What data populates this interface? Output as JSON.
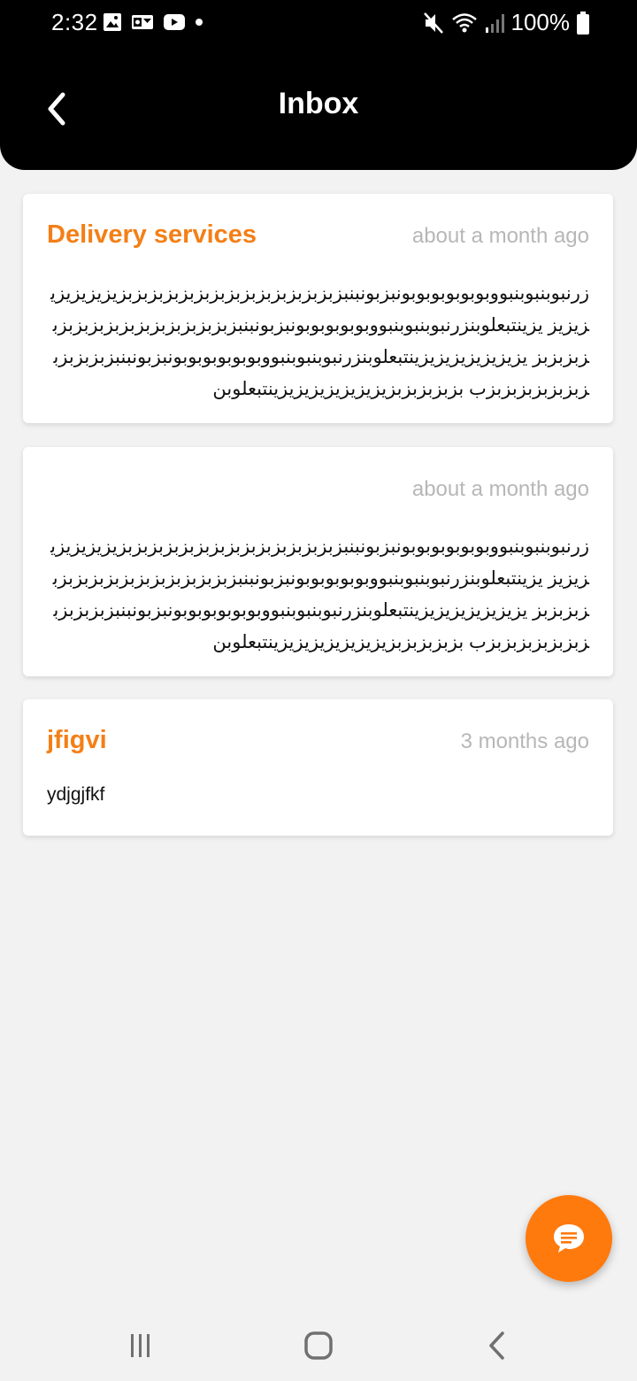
{
  "status_bar": {
    "time": "2:32",
    "battery": "100%",
    "icons_left": [
      "gallery-icon",
      "outlook-icon",
      "youtube-icon",
      "dot-icon"
    ],
    "icons_right": [
      "mute-icon",
      "wifi-icon",
      "signal-icon",
      "battery-icon"
    ]
  },
  "app_bar": {
    "title": "Inbox",
    "back_icon": "chevron-left-icon"
  },
  "messages": [
    {
      "title": "Delivery services",
      "time": "about a month ago",
      "body": "زرنبوبنبوبنبووبوبوبوبوبوبونبزبونبنبزبزبزبزبزبزبزبزبزبزبزبزبزبزبزيزيزيزيزيزيزيز يزينتبعلوبنزرنبوبنبوبنبووبوبوبوبوبونبزبونبنبزبزبزبزبزبزبزبزبزبزبزبزبزبزبزبز يزيزيزيزيزيزيزينتبعلوبنزرنبوبنبوبنبووبوبوبوبوبوبونبزبونبنبزبزبزبزبزبزبزبزبزبزبزب بزبزبزبزبزيزيزيزيزيزيزيزينتبعلوبن"
    },
    {
      "title": "",
      "time": "about a month ago",
      "body": "زرنبوبنبوبنبووبوبوبوبوبوبونبزبونبنبزبزبزبزبزبزبزبزبزبزبزبزبزبزبزيزيزيزيزيزيزيز يزينتبعلوبنزرنبوبنبوبنبووبوبوبوبوبونبزبونبنبزبزبزبزبزبزبزبزبزبزبزبزبزبزبزبز يزيزيزيزيزيزيزينتبعلوبنزرنبوبنبوبنبووبوبوبوبوبوبونبزبونبنبزبزبزبزبزبزبزبزبزبزبزب بزبزبزبزبزيزيزيزيزيزيزيزينتبعلوبن"
    },
    {
      "title": "jfigvi",
      "time": "3 months ago",
      "body": "ydjgjfkf"
    }
  ],
  "fab": {
    "icon": "chat-icon"
  },
  "system_nav": {
    "icons": [
      "recents-icon",
      "home-icon",
      "back-icon"
    ]
  },
  "colors": {
    "accent": "#f47f16",
    "fab": "#ff7a0d",
    "header_bg": "#000000",
    "page_bg": "#f2f2f2",
    "time_text": "#b7b7b7"
  }
}
